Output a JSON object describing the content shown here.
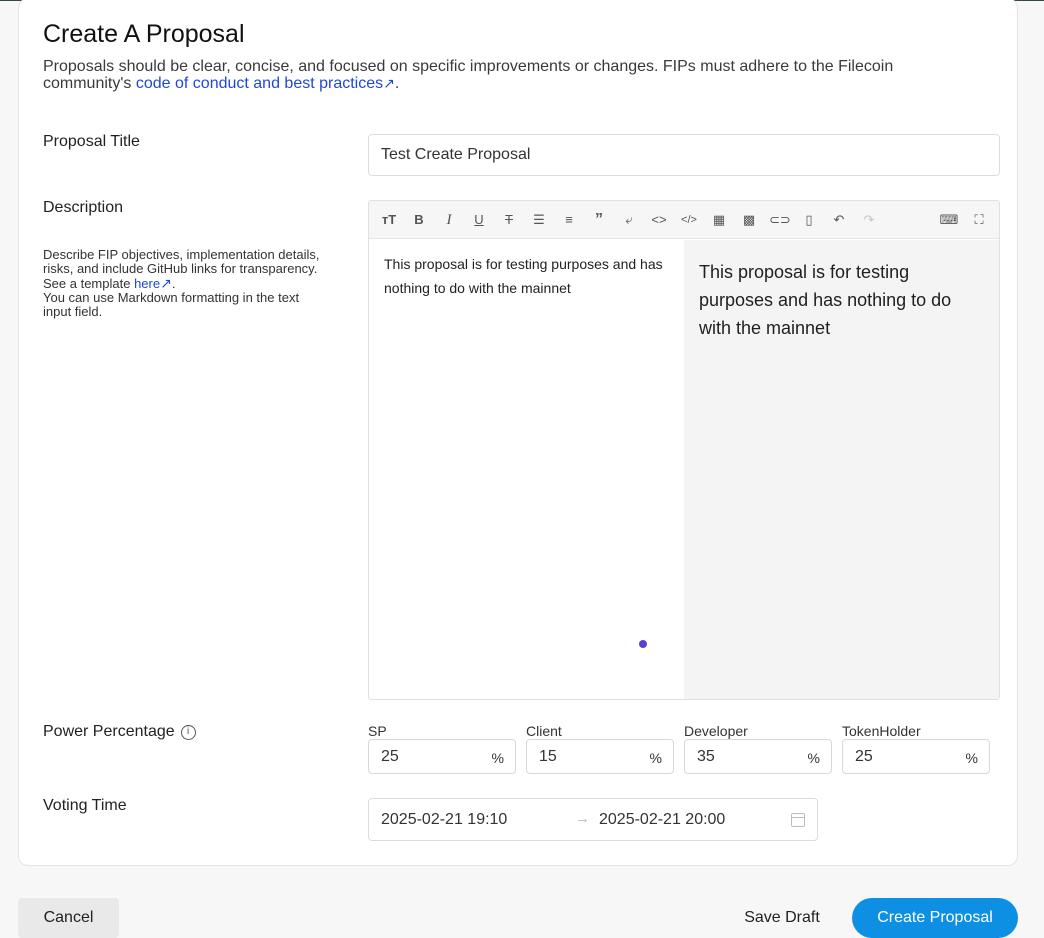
{
  "page": {
    "title": "Create A Proposal",
    "intro_text": "Proposals should be clear, concise, and focused on specific improvements or changes. FIPs must adhere to the Filecoin community's ",
    "intro_link": "code of conduct and best practices",
    "intro_end": "."
  },
  "fields": {
    "title_label": "Proposal Title",
    "title_value": "Test Create Proposal",
    "description_label": "Description",
    "description_help_1": "Describe FIP objectives, implementation details, risks, and include GitHub links for transparency. See a template ",
    "description_help_link": "here",
    "description_help_2": ".",
    "description_help_3": "You can use Markdown formatting in the text input field.",
    "description_value": "This proposal is for testing purposes and has nothing to do with the mainnet",
    "description_preview": "This proposal is for testing purposes and has nothing to do with the mainnet"
  },
  "toolbar": {
    "icons": [
      "heading-icon",
      "bold-icon",
      "italic-icon",
      "underline-icon",
      "strikethrough-icon",
      "unordered-list-icon",
      "ordered-list-icon",
      "quote-icon",
      "wrap-icon",
      "inline-code-icon",
      "code-block-icon",
      "table-icon",
      "image-icon",
      "link-icon",
      "delete-icon",
      "undo-icon",
      "redo-icon",
      "keyboard-icon",
      "fullscreen-icon"
    ]
  },
  "power": {
    "label": "Power Percentage",
    "suffix": "%",
    "items": [
      {
        "name": "SP",
        "value": "25"
      },
      {
        "name": "Client",
        "value": "15"
      },
      {
        "name": "Developer",
        "value": "35"
      },
      {
        "name": "TokenHolder",
        "value": "25"
      }
    ]
  },
  "voting": {
    "label": "Voting Time",
    "start": "2025-02-21 19:10",
    "separator": "→",
    "end": "2025-02-21 20:00"
  },
  "actions": {
    "cancel": "Cancel",
    "save_draft": "Save Draft",
    "create": "Create Proposal"
  },
  "colors": {
    "link": "#1e49d8",
    "primary": "#0d90e4",
    "cursor_dot": "#5b40d8"
  }
}
